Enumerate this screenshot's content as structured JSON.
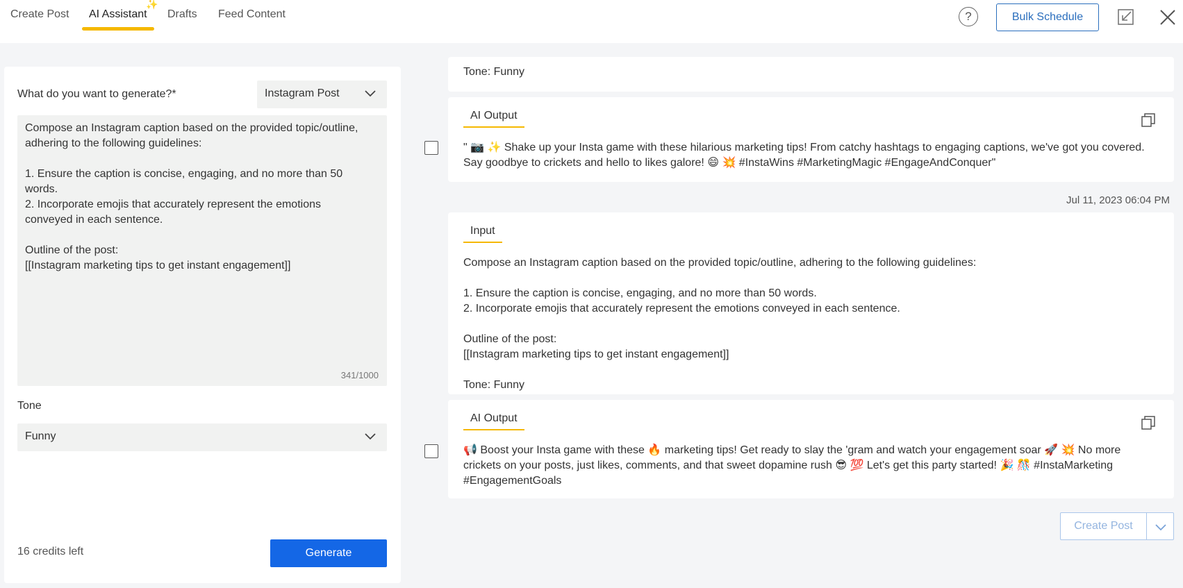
{
  "tabs": [
    {
      "label": "Create Post"
    },
    {
      "label": "AI Assistant"
    },
    {
      "label": "Drafts"
    },
    {
      "label": "Feed Content"
    }
  ],
  "active_tab": "AI Assistant",
  "header": {
    "help_symbol": "?",
    "bulk_schedule_label": "Bulk Schedule"
  },
  "form": {
    "generate_label": "What do you want to generate?*",
    "generate_type": "Instagram Post",
    "prompt": "Compose an Instagram caption based on the provided topic/outline,\nadhering to the following guidelines:\n\n1. Ensure the caption is concise, engaging, and no more than 50\nwords.\n2. Incorporate emojis that accurately represent the emotions\nconveyed in each sentence.\n\nOutline of the post:\n[[Instagram marketing tips to get instant engagement]]",
    "char_count": "341/1000",
    "tone_label": "Tone",
    "tone_value": "Funny",
    "credits": "16 credits left",
    "generate_button": "Generate"
  },
  "history": {
    "top_tone_text": "Tone: Funny",
    "output1": {
      "label": "AI Output",
      "text": "\" 📷 ✨ Shake up your Insta game with these hilarious marketing tips! From catchy hashtags to engaging captions, we've got you covered.\nSay goodbye to crickets and hello to likes galore! 😄 💥 #InstaWins #MarketingMagic #EngageAndConquer\""
    },
    "timestamp": "Jul 11, 2023 06:04 PM",
    "input2": {
      "label": "Input",
      "text": "Compose an Instagram caption based on the provided topic/outline, adhering to the following guidelines:\n\n1. Ensure the caption is concise, engaging, and no more than 50 words.\n2. Incorporate emojis that accurately represent the emotions conveyed in each sentence.\n\nOutline of the post:\n[[Instagram marketing tips to get instant engagement]]\n\nTone: Funny"
    },
    "output2": {
      "label": "AI Output",
      "text": "📢 Boost your Insta game with these 🔥 marketing tips! Get ready to slay the 'gram and watch your engagement soar 🚀 💥 No more\ncrickets on your posts, just likes, comments, and that sweet dopamine rush 😎 💯 Let's get this party started! 🎉 🎊 #InstaMarketing\n#EngagementGoals"
    }
  },
  "footer": {
    "create_post_label": "Create Post"
  },
  "colors": {
    "accent_underline": "#f5b800",
    "primary_blue": "#1467e6",
    "link_blue": "#2a6ebd"
  }
}
